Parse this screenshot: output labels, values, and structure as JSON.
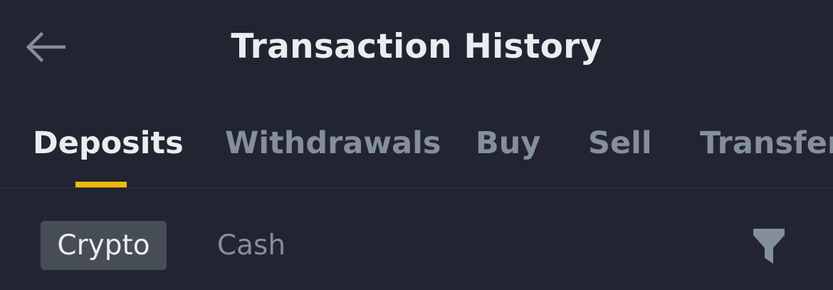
{
  "header": {
    "title": "Transaction History",
    "back_icon": "arrow-left-icon"
  },
  "tabs": [
    {
      "label": "Deposits",
      "active": true
    },
    {
      "label": "Withdrawals",
      "active": false
    },
    {
      "label": "Buy",
      "active": false
    },
    {
      "label": "Sell",
      "active": false
    },
    {
      "label": "Transfer",
      "active": false
    }
  ],
  "subtabs": [
    {
      "label": "Crypto",
      "active": true
    },
    {
      "label": "Cash",
      "active": false
    }
  ],
  "filter_icon": "filter-icon",
  "colors": {
    "background": "#222531",
    "accent": "#f0b90b",
    "text_primary": "#eaecef",
    "text_secondary": "#848e9c",
    "chip_active_bg": "#474d57"
  }
}
